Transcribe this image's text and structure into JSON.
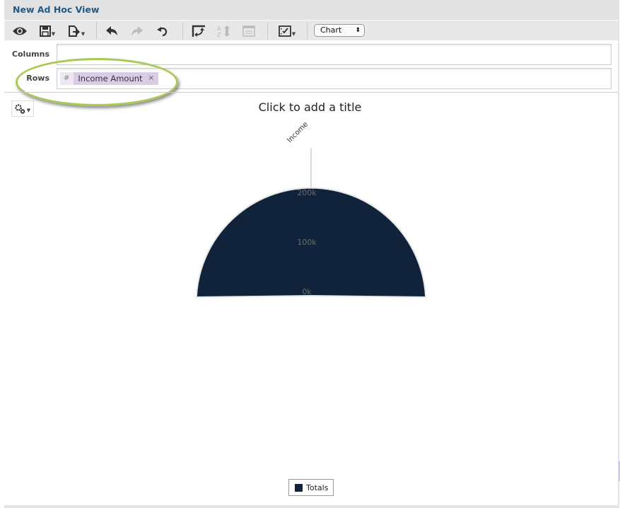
{
  "window": {
    "title": "New Ad Hoc View"
  },
  "toolbar": {
    "buttons": [
      {
        "name": "display-mode-button",
        "icon": "eye-icon"
      },
      {
        "name": "save-button",
        "icon": "save-icon",
        "dropdown": true
      },
      {
        "name": "export-button",
        "icon": "export-icon",
        "dropdown": true
      },
      {
        "name": "undo-button",
        "icon": "undo-icon"
      },
      {
        "name": "redo-button",
        "icon": "redo-icon",
        "disabled": true
      },
      {
        "name": "undo-all-button",
        "icon": "undo-all-icon"
      },
      {
        "name": "switch-axes-button",
        "icon": "pivot-icon"
      },
      {
        "name": "sort-button",
        "icon": "sort-az-icon",
        "disabled": true
      },
      {
        "name": "input-controls-button",
        "icon": "list-icon",
        "disabled": true
      },
      {
        "name": "chart-options-button",
        "icon": "checklist-icon",
        "dropdown": true
      }
    ],
    "view_type": {
      "selected": "Chart"
    }
  },
  "fields": {
    "columns_label": "Columns",
    "rows_label": "Rows",
    "rows_items": [
      {
        "type_symbol": "#",
        "label": "Income Amount",
        "remove": "×"
      }
    ]
  },
  "chart": {
    "title_placeholder": "Click to add a title"
  },
  "chart_data": {
    "type": "polar",
    "title": "Click to add a title",
    "categories": [
      "Income"
    ],
    "series": [
      {
        "name": "Totals",
        "values": [
          232000
        ],
        "color": "#10233a"
      }
    ],
    "radial_axis": {
      "ticks": [
        "0k",
        "100k",
        "200k"
      ],
      "tick_values": [
        0,
        100000,
        200000
      ],
      "range": [
        0,
        290000
      ]
    },
    "legend": {
      "entries": [
        "Totals"
      ],
      "position": "bottom-center"
    }
  }
}
